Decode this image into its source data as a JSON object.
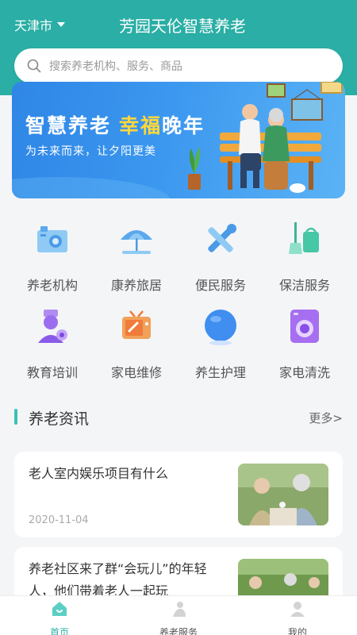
{
  "header": {
    "city": "天津市",
    "title": "芳园天伦智慧养老"
  },
  "search": {
    "placeholder": "搜索养老机构、服务、商品"
  },
  "banner": {
    "slogan_part1": "智慧养老",
    "slogan_highlight": "幸福",
    "slogan_part2": "晚年",
    "subtitle": "为未来而来，让夕阳更美"
  },
  "services": [
    {
      "label": "养老机构",
      "icon": "nursing-home-icon"
    },
    {
      "label": "康养旅居",
      "icon": "beach-umbrella-icon"
    },
    {
      "label": "便民服务",
      "icon": "tools-icon"
    },
    {
      "label": "保洁服务",
      "icon": "cleaning-icon"
    },
    {
      "label": "教育培训",
      "icon": "teacher-icon"
    },
    {
      "label": "家电维修",
      "icon": "tv-repair-icon"
    },
    {
      "label": "养生护理",
      "icon": "care-ball-icon"
    },
    {
      "label": "家电清洗",
      "icon": "washing-machine-icon"
    }
  ],
  "news_section": {
    "title": "养老资讯",
    "more": "更多>"
  },
  "news": [
    {
      "title": "老人室内娱乐项目有什么",
      "date": "2020-11-04"
    },
    {
      "title": "养老社区来了群“会玩儿”的年轻人，他们带着老人一起玩",
      "date": ""
    }
  ],
  "tabbar": {
    "tabs": [
      {
        "label": "首页",
        "icon": "home-icon",
        "active": true
      },
      {
        "label": "养老服务",
        "icon": "elderly-service-icon",
        "active": false
      },
      {
        "label": "我的",
        "icon": "user-icon",
        "active": false
      }
    ]
  },
  "colors": {
    "brand": "#2aaea5",
    "accent": "#ffd73b"
  }
}
